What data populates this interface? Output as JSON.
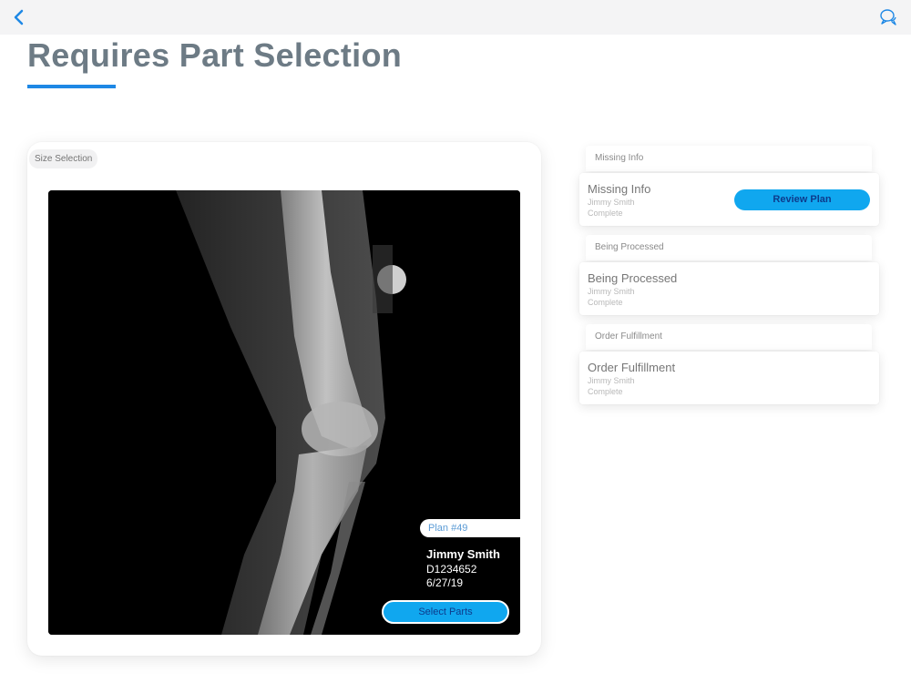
{
  "topbar": {
    "back_icon": "chevron-left-icon",
    "chat_icon": "chat-bubbles-icon"
  },
  "page": {
    "title": "Requires Part Selection"
  },
  "size_selection": {
    "chip_label": "Size Selection",
    "plan_label": "Plan #49",
    "patient_name": "Jimmy Smith",
    "patient_id": "D1234652",
    "date": "6/27/19",
    "select_parts_label": "Select Parts"
  },
  "sections": [
    {
      "header": "Missing Info",
      "title": "Missing Info",
      "name": "Jimmy Smith",
      "status": "Complete",
      "button": "Review Plan"
    },
    {
      "header": "Being Processed",
      "title": "Being Processed",
      "name": "Jimmy Smith",
      "status": "Complete"
    },
    {
      "header": "Order Fulfillment",
      "title": "Order Fulfillment",
      "name": "Jimmy Smith",
      "status": "Complete"
    }
  ],
  "colors": {
    "accent": "#1e88e5",
    "button": "#10a7ef",
    "title": "#6d7b85"
  }
}
